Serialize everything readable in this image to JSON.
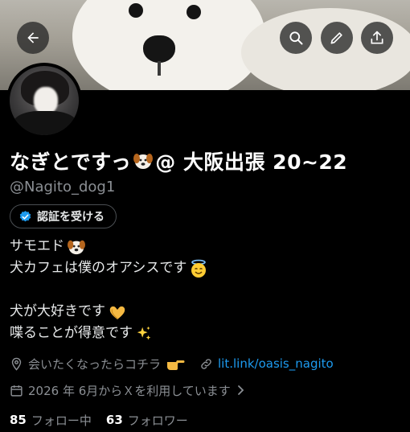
{
  "header": {
    "back_icon": "arrow-left-icon",
    "search_icon": "search-icon",
    "edit_icon": "pencil-icon",
    "share_icon": "share-icon"
  },
  "profile": {
    "display_name": "なぎとですっ",
    "name_emoji": "dog-face-emoji",
    "name_suffix": "@ 大阪出張 20~22",
    "handle": "@Nagito_dog1",
    "verify_button_label": "認証を受ける",
    "bio_lines": [
      "サモエド",
      "犬カフェは僕のオアシスです",
      "",
      "犬が大好きです",
      "喋ることが得意です"
    ],
    "location_text": "会いたくなったらコチラ",
    "link_text": "lit.link/oasis_nagito",
    "joined_text": "2026 年 6月からＸを利用しています",
    "following_count": "85",
    "following_label": "フォロー中",
    "followers_count": "63",
    "followers_label": "フォロワー"
  },
  "colors": {
    "accent": "#1d9bf0",
    "muted_text": "#8b8f94",
    "background": "#000000"
  }
}
